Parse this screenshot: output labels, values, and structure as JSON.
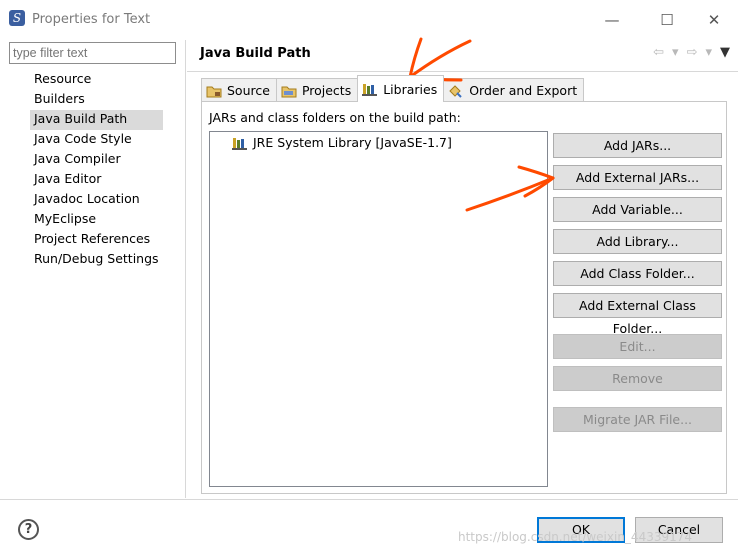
{
  "window": {
    "title": "Properties for Text",
    "app_icon": "myeclipse-logo-icon"
  },
  "filter": {
    "placeholder": "type filter text"
  },
  "nav": [
    {
      "label": "Resource"
    },
    {
      "label": "Builders"
    },
    {
      "label": "Java Build Path",
      "selected": true
    },
    {
      "label": "Java Code Style"
    },
    {
      "label": "Java Compiler"
    },
    {
      "label": "Java Editor"
    },
    {
      "label": "Javadoc Location"
    },
    {
      "label": "MyEclipse"
    },
    {
      "label": "Project References"
    },
    {
      "label": "Run/Debug Settings"
    }
  ],
  "page": {
    "title": "Java Build Path"
  },
  "tabs": [
    {
      "label": "Source",
      "icon": "source-folder-icon"
    },
    {
      "label": "Projects",
      "icon": "projects-folder-icon"
    },
    {
      "label": "Libraries",
      "icon": "library-icon",
      "active": true
    },
    {
      "label": "Order and Export",
      "icon": "order-export-icon"
    }
  ],
  "libraries": {
    "label": "JARs and class folders on the build path:",
    "items": [
      {
        "label": "JRE System Library [JavaSE-1.7]",
        "icon": "library-icon"
      }
    ]
  },
  "buttons": {
    "add_jars": "Add JARs...",
    "add_external_jars": "Add External JARs...",
    "add_variable": "Add Variable...",
    "add_library": "Add Library...",
    "add_class_folder": "Add Class Folder...",
    "add_external_class_folder": "Add External Class Folder...",
    "edit": "Edit...",
    "remove": "Remove",
    "migrate_jar": "Migrate JAR File..."
  },
  "dialog": {
    "help": "?",
    "ok": "OK",
    "cancel": "Cancel"
  },
  "watermark": "https://blog.csdn.net/weixin_44339174",
  "colors": {
    "annotation": "#ff4a00",
    "default_button_border": "#0078d7",
    "selection": "#dadada"
  }
}
